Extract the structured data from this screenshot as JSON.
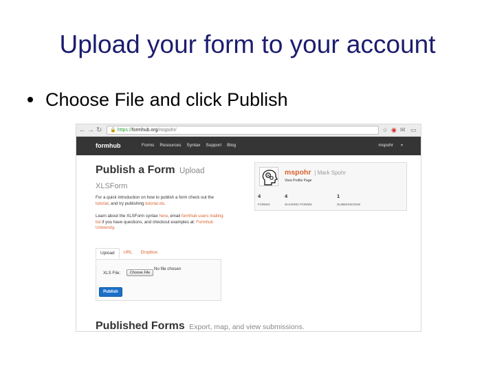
{
  "slide": {
    "title": "Upload your form to your account",
    "bullet": "Choose File and click Publish"
  },
  "browser": {
    "url_scheme": "https://",
    "url_host": "formhub.org",
    "url_path": "/mspohr/"
  },
  "header": {
    "brand": "formhub",
    "nav": [
      "Forms",
      "Resources",
      "Syntax",
      "Support",
      "Blog"
    ],
    "user": "mspohr"
  },
  "publish": {
    "title": "Publish a Form",
    "title_suffix": "Upload",
    "subtitle": "XLSForm",
    "para1_a": "For a quick introduction on how to publish a form check out the ",
    "para1_link1": "tutorial",
    "para1_b": ", and try publishing ",
    "para1_link2": "tutorial.xls",
    "para1_c": ".",
    "para2_a": "Learn about the XLSForm syntax ",
    "para2_link1": "here",
    "para2_b": ", email ",
    "para2_link2": "formhub users mailing list",
    "para2_c": " if you have questions, and checkout examples at: ",
    "para2_link3": "Formhub University",
    "para2_d": "."
  },
  "tabs": [
    "Upload",
    "URL",
    "Dropbox"
  ],
  "upload": {
    "xls_label": "XLS File:",
    "choose_button": "Choose File",
    "no_file": "No file chosen",
    "publish_button": "Publish"
  },
  "profile": {
    "username": "mspohr",
    "fullname": "| Mark Spohr",
    "view_link": "View Profile Page",
    "stats": [
      {
        "value": "4",
        "label": "FORMS"
      },
      {
        "value": "4",
        "label": "SHARED FORMS"
      },
      {
        "value": "1",
        "label": "SUBMISSIONS"
      }
    ]
  },
  "published_forms": {
    "title": "Published Forms",
    "subtitle": "Export, map, and view submissions."
  },
  "colors": {
    "title": "#1c1c6e",
    "link": "#d9602b",
    "header_bg": "#353535",
    "publish_button": "#1a6fc8"
  }
}
